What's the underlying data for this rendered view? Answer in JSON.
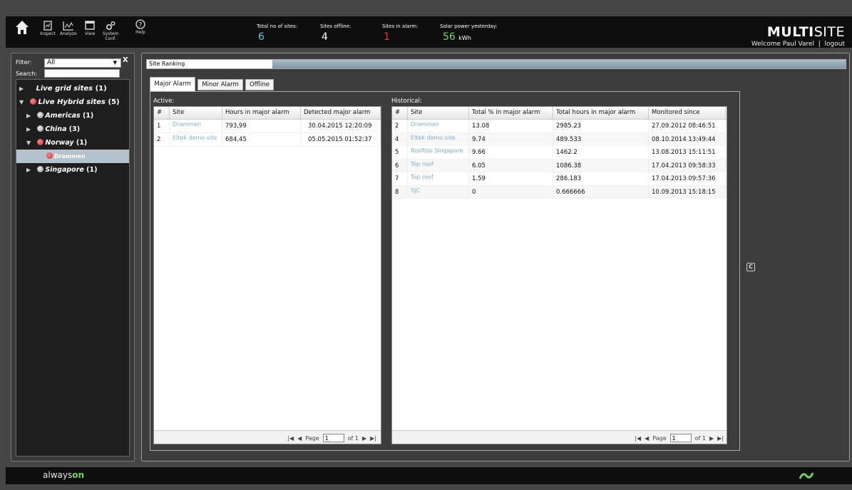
{
  "nav": {
    "inspect": "Inspect",
    "analyze": "Analyze",
    "view": "View",
    "system_conf": "System Conf.",
    "help": "Help"
  },
  "stats": {
    "total_label": "Total no of sites:",
    "total_value": "6",
    "offline_label": "Sites offline:",
    "offline_value": "4",
    "alarm_label": "Sites in alarm:",
    "alarm_value": "1",
    "solar_label": "Solar power yesterday:",
    "solar_value": "56",
    "solar_unit": "kWh",
    "colors": {
      "total": "#5fc8e8",
      "alarm": "#e43b3b",
      "solar": "#6fd35c"
    }
  },
  "brand": {
    "bold": "MULTI",
    "light": "SITE",
    "welcome": "Welcome Paul Varel",
    "separator": "|",
    "logout": "logout"
  },
  "sidebar": {
    "filter_label": "Filter:",
    "filter_value": "All",
    "filter_clear": "X",
    "search_label": "Search:",
    "search_value": "",
    "tree": [
      {
        "label": "Live grid sites",
        "count": "(1)",
        "expanded": false
      },
      {
        "label": "Live Hybrid sites",
        "count": "(5)",
        "expanded": true
      },
      {
        "label": "Americas",
        "count": "(1)"
      },
      {
        "label": "China",
        "count": "(3)"
      },
      {
        "label": "Norway",
        "count": "(1)"
      },
      {
        "label": "Drammen",
        "selected": true
      },
      {
        "label": "Singapore",
        "count": "(1)"
      }
    ]
  },
  "main": {
    "title": "Site Ranking",
    "tabs": [
      "Major Alarm",
      "Minor Alarm",
      "Offline"
    ],
    "active_tab": "Major Alarm",
    "refresh_icon": "C",
    "active": {
      "label": "Active:",
      "columns": [
        "#",
        "Site",
        "Hours in major alarm",
        "Detected major alarm"
      ],
      "rows": [
        [
          "1",
          "Drammen",
          "793,99",
          "30.04.2015  12:20:09"
        ],
        [
          "2",
          "Eltek demo site",
          "684,45",
          "05.05.2015  01:52:37"
        ]
      ]
    },
    "historical": {
      "label": "Historical:",
      "columns": [
        "#",
        "Site",
        "Total % in major alarm",
        "Total hours in major alarm",
        "Monitored since"
      ],
      "rows": [
        [
          "2",
          "Drammen",
          "13.08",
          "2985.23",
          "27.09.2012  08:46:51"
        ],
        [
          "4",
          "Eltek demo site",
          "9.74",
          "489.533",
          "08.10.2014  13:49:44"
        ],
        [
          "5",
          "Rooftop Singapore",
          "9.66",
          "1462.2",
          "13.08.2013  15:11:51"
        ],
        [
          "6",
          "Top roof",
          "6.05",
          "1086.38",
          "17.04.2013  09:58:33"
        ],
        [
          "7",
          "Top roof",
          "1.59",
          "286.183",
          "17.04.2013  09:57:36"
        ],
        [
          "8",
          "SJC",
          "0",
          "0.666666",
          "10.09.2013  15:18:15"
        ]
      ]
    },
    "pager": {
      "page_label": "Page",
      "page_value": "1",
      "of_label": "of 1"
    }
  },
  "footer": {
    "logo_always": "always",
    "logo_on": "on"
  }
}
